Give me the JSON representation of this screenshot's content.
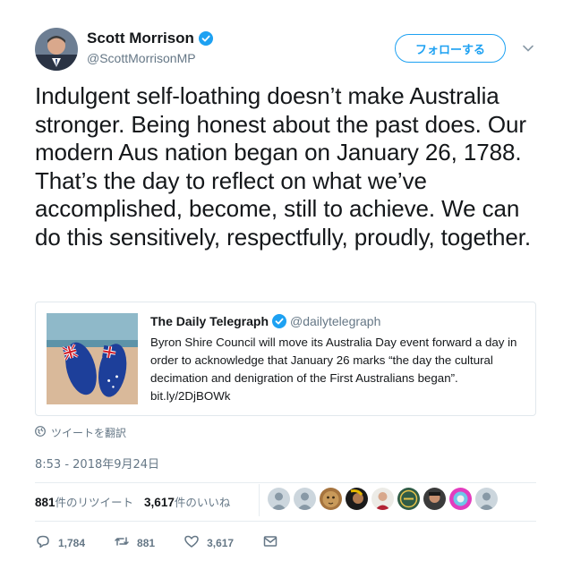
{
  "author": {
    "name": "Scott Morrison",
    "handle": "@ScottMorrisonMP",
    "follow_label": "フォローする"
  },
  "tweet": {
    "text": "Indulgent self-loathing doesn’t make Australia stronger. Being honest about the past does. Our modern Aus nation began on January 26, 1788. That’s the day to reflect on what we’ve accomplished, become, still to achieve. We can do this sensitively, respectfully, proudly, together."
  },
  "quoted": {
    "name": "The Daily Telegraph",
    "handle": "@dailytelegraph",
    "text": "Byron Shire Council will move its Australia Day event forward a day in order to acknowledge that January 26 marks “the day the cultural decimation and denigration of the First Australians began”.",
    "link": "bit.ly/2DjBOWk"
  },
  "translate_label": "ツイートを翻訳",
  "timestamp": "8:53 - 2018年9月24日",
  "stats": {
    "retweets_count": "881",
    "retweets_label": "件のリツイート",
    "likes_count": "3,617",
    "likes_label": "件のいいね"
  },
  "actions": {
    "replies": "1,784",
    "retweets": "881",
    "likes": "3,617"
  },
  "colors": {
    "accent": "#1da1f2",
    "muted": "#657786",
    "text": "#14171a"
  }
}
